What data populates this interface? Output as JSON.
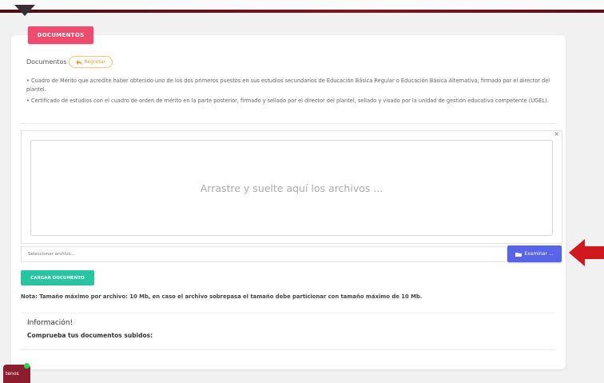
{
  "header": {
    "accent_color": "#6e1820"
  },
  "section": {
    "badge": "DOCUMENTOS",
    "documentos_label": "Documentos",
    "back_button": {
      "label": "Regresar",
      "icon": "reply-icon"
    }
  },
  "requirements": [
    "•   Cuadro de Mérito que acredite haber obtenido uno de los dos primeros puestos en sus estudios secundarios de Educación Básica Regular o Educación Básica Alternativa, firmado por el director del plantel.",
    "•   Certificado de estudios con el cuadro de orden de mérito en la parte posterior, firmado y sellado por el director del plantel, sellado y visado por la unidad de gestión educativa competente (UGEL)."
  ],
  "upload": {
    "close_symbol": "×",
    "drop_text": "Arrastre y suelte aquí los archivos ...",
    "file_placeholder": "Seleccionar archivo...",
    "browse_button": "Examinar ...",
    "browse_icon": "folder-icon",
    "browse_color": "#5965e8"
  },
  "actions": {
    "cargar_label": "CARGAR DOCUMENTO",
    "cargar_color": "#27c6a0"
  },
  "note": "Nota: Tamaño máximo por archivo: 10 Mb, en caso el archivo sobrepasa el tamaño debe particionar con tamaño máximo de 10 Mb.",
  "info": {
    "title": "Información!",
    "subtitle": "Comprueba tus documentos subidos:"
  },
  "chat": {
    "label": "tenos",
    "status_color": "#31d25a"
  },
  "annotation": {
    "arrow_color": "#d0191f",
    "icon": "arrow-left-icon"
  }
}
